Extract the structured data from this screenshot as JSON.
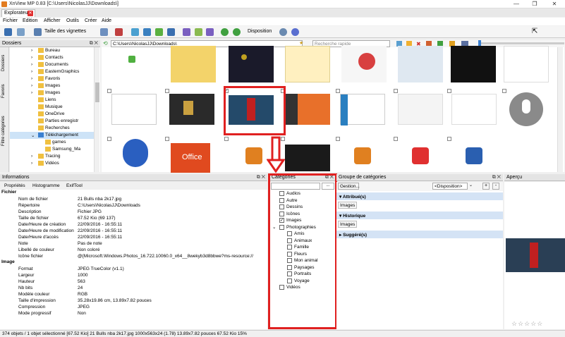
{
  "window": {
    "title": "XnView MP 0.83 [C:\\Users\\NicolasJJ\\Downloads\\]",
    "controls": [
      "—",
      "❐",
      "✕"
    ]
  },
  "tabs": [
    {
      "label": "Explorateur"
    }
  ],
  "menu": [
    "Fichier",
    "Edition",
    "Afficher",
    "Outils",
    "Créer",
    "Aide"
  ],
  "toolbar": {
    "thumb_size_label": "Taille des vignettes",
    "disposition_label": "Disposition"
  },
  "folders_panel": {
    "title": "Dossiers",
    "side_tabs": [
      "Dossiers",
      "Favoris",
      "Filtre catégories"
    ],
    "items": [
      {
        "label": "Bureau",
        "indent": 1,
        "expander": "›"
      },
      {
        "label": "Contacts",
        "indent": 1,
        "expander": "›"
      },
      {
        "label": "Documents",
        "indent": 1,
        "expander": "›"
      },
      {
        "label": "EasternGraphics",
        "indent": 1,
        "expander": "›"
      },
      {
        "label": "Favoris",
        "indent": 1,
        "expander": "›"
      },
      {
        "label": "Images",
        "indent": 1,
        "expander": "›"
      },
      {
        "label": "Images",
        "indent": 1,
        "expander": "›"
      },
      {
        "label": "Liens",
        "indent": 1,
        "expander": ""
      },
      {
        "label": "Musique",
        "indent": 1,
        "expander": ""
      },
      {
        "label": "OneDrive",
        "indent": 1,
        "expander": ""
      },
      {
        "label": "Parties enregistr",
        "indent": 1,
        "expander": ""
      },
      {
        "label": "Recherches",
        "indent": 1,
        "expander": ""
      },
      {
        "label": "Téléchargement",
        "indent": 1,
        "expander": "⌄",
        "selected": true
      },
      {
        "label": "games",
        "indent": 2,
        "expander": ""
      },
      {
        "label": "Samsung_Ma",
        "indent": 2,
        "expander": ""
      },
      {
        "label": "Tracing",
        "indent": 1,
        "expander": "›"
      },
      {
        "label": "Vidéos",
        "indent": 1,
        "expander": "›"
      }
    ]
  },
  "address_bar": {
    "path": "C:\\Users\\NicolasJJ\\Downloads\\",
    "search_placeholder": "Recherche rapide"
  },
  "info_panel": {
    "title": "Informations",
    "tabs": [
      "Propriétés",
      "Histogramme",
      "ExifTool"
    ],
    "sections": [
      {
        "name": "Fichier",
        "rows": [
          {
            "k": "Nom de fichier",
            "v": "21 Bulls nba 2k17.jpg"
          },
          {
            "k": "Répertoire",
            "v": "C:\\Users\\NicolasJJ\\Downloads"
          },
          {
            "k": "Description",
            "v": "Fichier JPG"
          },
          {
            "k": "Taille de fichier",
            "v": "67.52 Kio (69 137)"
          },
          {
            "k": "Date/Heure de création",
            "v": "22/09/2016 - 16:55:11"
          },
          {
            "k": "Date/Heure de modification",
            "v": "22/09/2016 - 16:55:11"
          },
          {
            "k": "Date/Heure d'accès",
            "v": "22/09/2016 - 16:55:11"
          },
          {
            "k": "Note",
            "v": "Pas de note"
          },
          {
            "k": "Libellé de couleur",
            "v": "Non coloré"
          },
          {
            "k": "Icône fichier",
            "v": "@{Microsoft.Windows.Photos_16.722.10060.0_x64__8wekyb3d8bbwe?ms-resource://"
          }
        ]
      },
      {
        "name": "Image",
        "rows": [
          {
            "k": "Format",
            "v": "JPEG TrueColor (v1.1)"
          },
          {
            "k": "Largeur",
            "v": "1000"
          },
          {
            "k": "Hauteur",
            "v": "563"
          },
          {
            "k": "Nb bits",
            "v": "24"
          },
          {
            "k": "Modèle couleur",
            "v": "RGB"
          },
          {
            "k": "Taille d'impression",
            "v": "35.28x19.86 cm, 13.89x7.82 pouces"
          },
          {
            "k": "Compression",
            "v": "JPEG"
          },
          {
            "k": "Mode progressif",
            "v": "Non"
          }
        ]
      }
    ]
  },
  "categories_panel": {
    "title": "Catégories",
    "dropdown_btn": "...",
    "items": [
      {
        "label": "Audios",
        "level": 0,
        "checked": false
      },
      {
        "label": "Autre",
        "level": 0,
        "checked": false
      },
      {
        "label": "Dessins",
        "level": 0,
        "checked": false
      },
      {
        "label": "Icônes",
        "level": 0,
        "checked": false
      },
      {
        "label": "Images",
        "level": 0,
        "checked": true
      },
      {
        "label": "Photographies",
        "level": 0,
        "checked": false,
        "expanded": true
      },
      {
        "label": "Amis",
        "level": 1,
        "checked": false
      },
      {
        "label": "Animaux",
        "level": 1,
        "checked": false
      },
      {
        "label": "Famille",
        "level": 1,
        "checked": false
      },
      {
        "label": "Fleurs",
        "level": 1,
        "checked": false
      },
      {
        "label": "Mon animal",
        "level": 1,
        "checked": false
      },
      {
        "label": "Paysages",
        "level": 1,
        "checked": false
      },
      {
        "label": "Portraits",
        "level": 1,
        "checked": false
      },
      {
        "label": "Voyage",
        "level": 1,
        "checked": false
      },
      {
        "label": "Vidéos",
        "level": 0,
        "checked": false
      }
    ]
  },
  "groups_panel": {
    "title": "Groupe de catégories",
    "gestion_label": "Gestion...",
    "disposition_select": "<Disposition>",
    "btn_add": "+",
    "btn_remove": "-",
    "sections": [
      {
        "name": "Attribué(s)",
        "tag": "Images"
      },
      {
        "name": "Historique",
        "tag": "Images"
      },
      {
        "name": "Suggéré(s)",
        "tag": ""
      }
    ]
  },
  "preview_panel": {
    "title": "Aperçu",
    "stars": "☆☆☆☆☆"
  },
  "status": {
    "text": "374 objets / 1 objet sélectionné [67.52 Kio]  21 Bulls nba 2k17.jpg  1000x563x24 (1.78)  13.89x7.82 pouces  67.52 Kio  15%"
  },
  "colors": {
    "accent": "#e02020",
    "selection": "#cde3f7",
    "group_header": "#d4e3f5"
  },
  "icons": [
    "back-icon",
    "forward-icon",
    "up-icon",
    "refresh-icon",
    "settings-icon",
    "help-icon",
    "star-icon",
    "filter-icon",
    "folder-icon",
    "down-arrow-icon"
  ]
}
